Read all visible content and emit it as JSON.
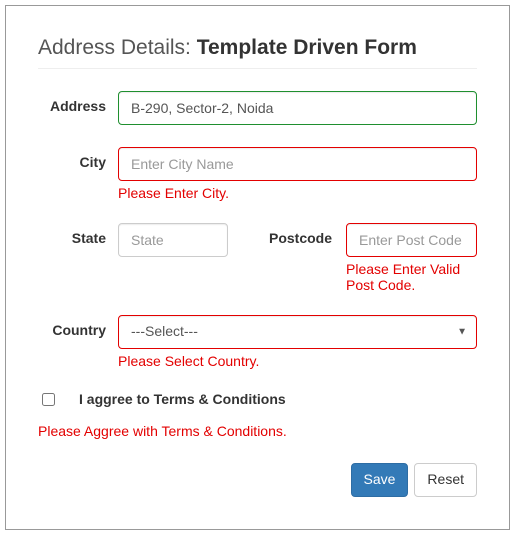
{
  "title_prefix": "Address Details: ",
  "title_bold": "Template Driven Form",
  "labels": {
    "address": "Address",
    "city": "City",
    "state": "State",
    "postcode": "Postcode",
    "country": "Country",
    "terms": "I aggree to Terms & Conditions"
  },
  "fields": {
    "address": {
      "value": "B-290, Sector-2, Noida",
      "placeholder": ""
    },
    "city": {
      "value": "",
      "placeholder": "Enter City Name"
    },
    "state": {
      "value": "",
      "placeholder": "State"
    },
    "postcode": {
      "value": "",
      "placeholder": "Enter Post Code"
    },
    "country_selected": "---Select---"
  },
  "errors": {
    "city": "Please Enter City.",
    "postcode": "Please Enter Valid Post Code.",
    "country": "Please Select Country.",
    "terms": "Please Aggree with Terms & Conditions."
  },
  "buttons": {
    "save": "Save",
    "reset": "Reset"
  }
}
